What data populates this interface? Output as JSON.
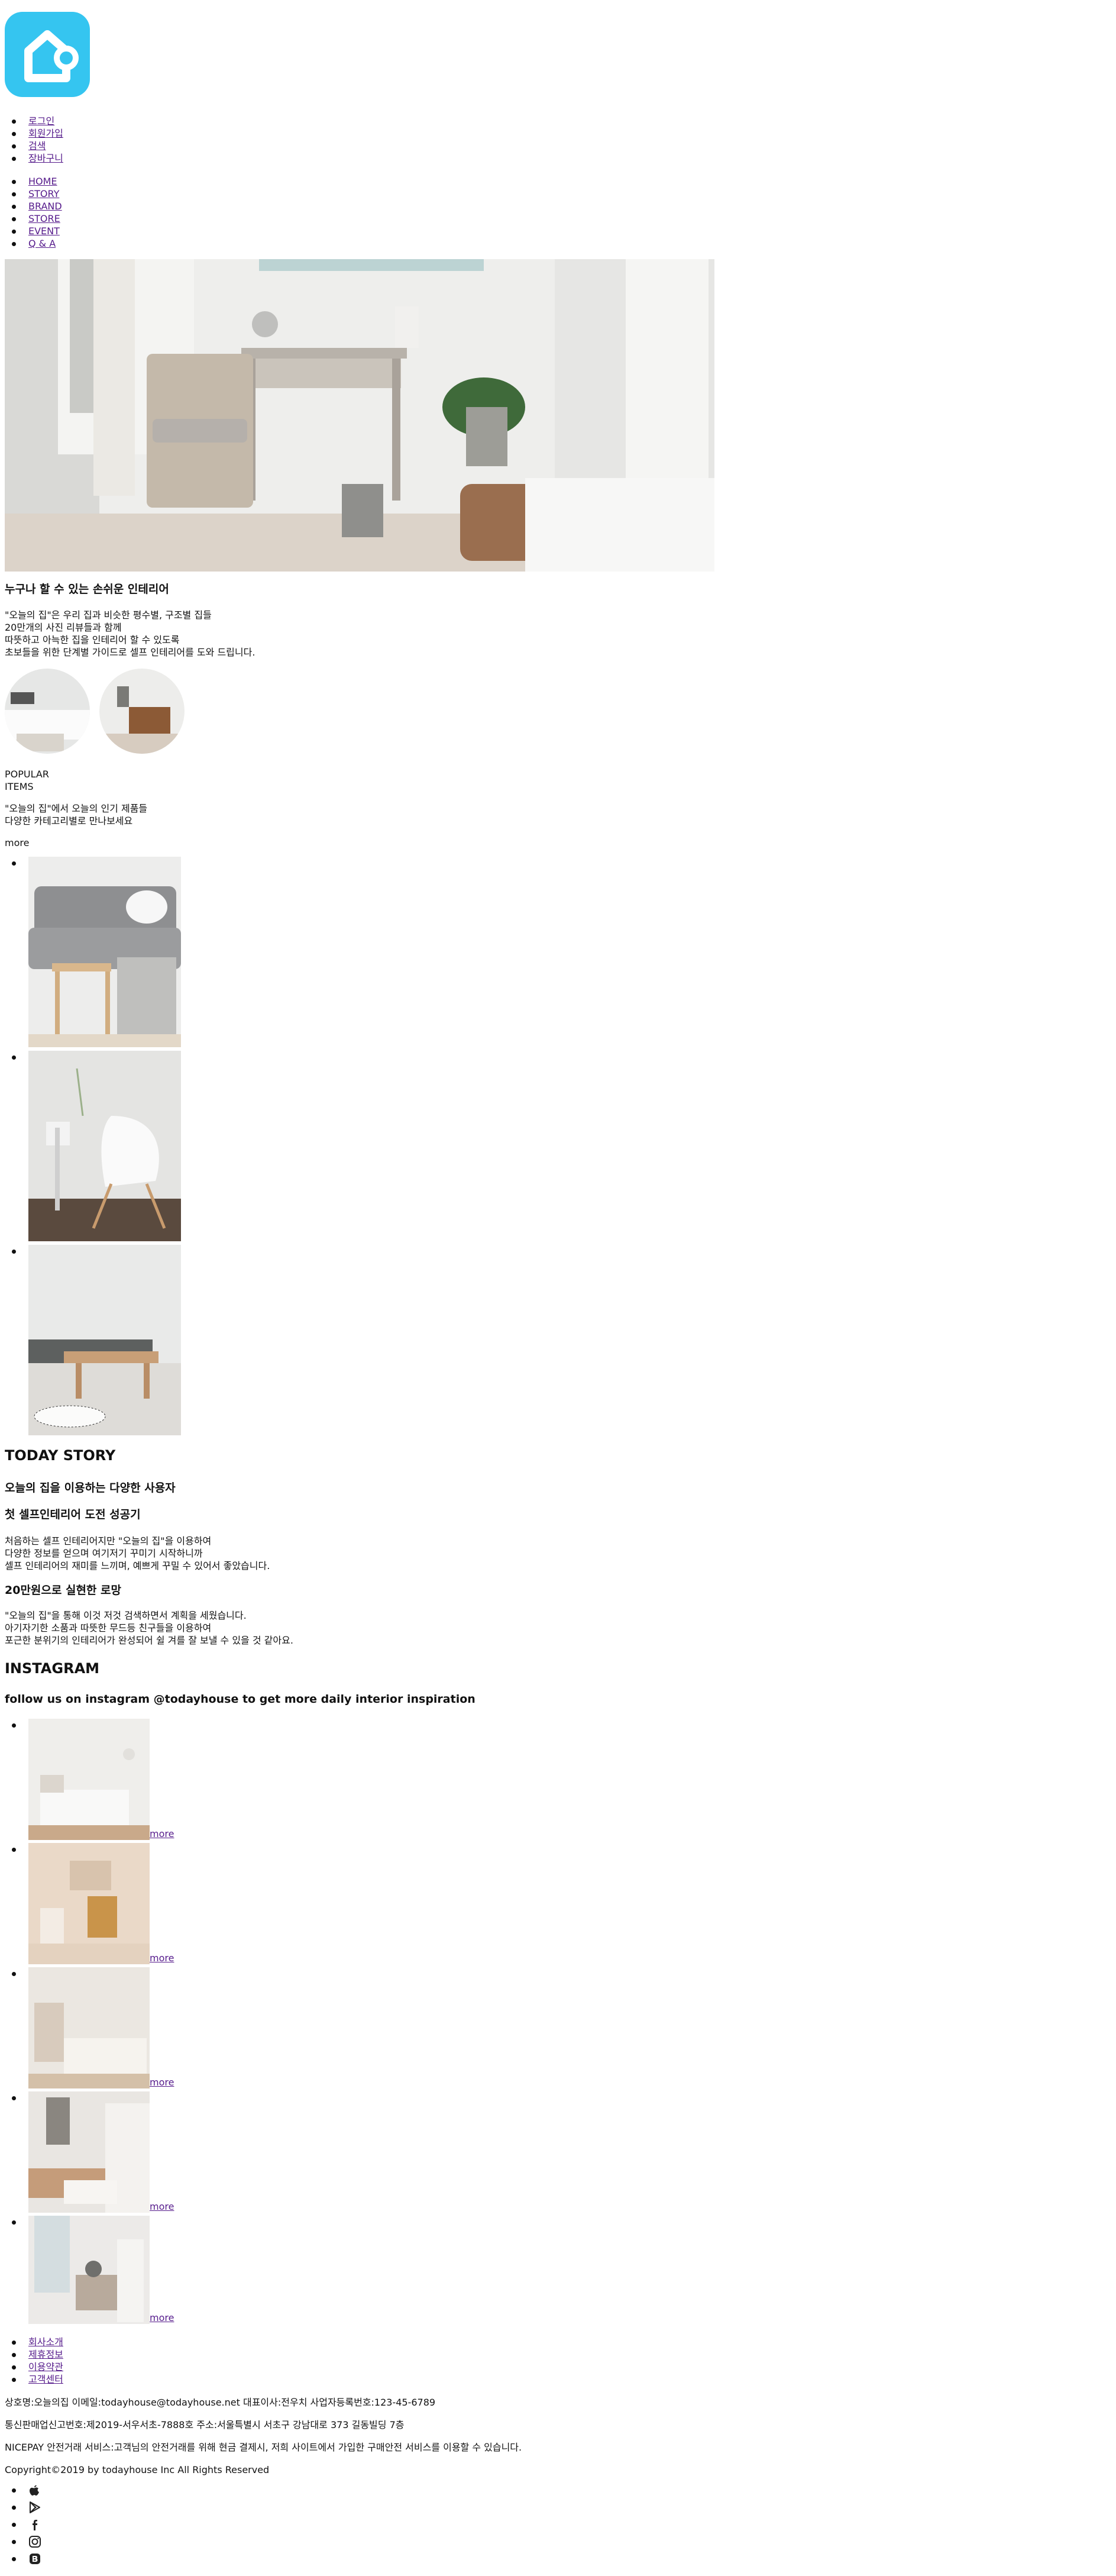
{
  "header": {
    "logo_icon": "house-logo-icon",
    "top_links": [
      "로그인",
      "회원가입",
      "검색",
      "장바구니"
    ],
    "nav": [
      "HOME",
      "STORY",
      "BRAND",
      "STORE",
      "EVENT",
      "Q & A"
    ]
  },
  "intro": {
    "title": "누구나 할 수 있는 손쉬운 인테리어",
    "lines": [
      "\"오늘의 집\"은 우리 집과 비슷한 평수별, 구조별 집들",
      "20만개의 사진 리뷰들과 함께",
      "따뜻하고 아늑한 집을 인테리어 할 수 있도록",
      "초보들을 위한 단계별 가이드로 셀프 인테리어를 도와 드립니다."
    ]
  },
  "popular": {
    "label_1": "POPULAR",
    "label_2": "ITEMS",
    "desc_1": "\"오늘의 집\"에서 오늘의 인기 제품들",
    "desc_2": "다양한 카테고리별로 만나보세요",
    "more": "more"
  },
  "story": {
    "heading": "TODAY STORY",
    "subheading": "오늘의 집을 이용하는 다양한 사용자",
    "post1_title": "첫 셀프인테리어 도전 성공기",
    "post1_lines": [
      "처음하는 셀프 인테리어지만 \"오늘의 집\"을 이용하여",
      "다양한 정보를 얻으며 여기저기 꾸미기 시작하니까",
      "셀프 인테리어의 재미를 느끼며, 예쁘게 꾸밀 수 있어서 좋았습니다."
    ],
    "post2_title": "20만원으로 실현한 로망",
    "post2_lines": [
      "\"오늘의 집\"을 통해 이것 저것 검색하면서 계획을 세웠습니다.",
      "아기자기한 소품과 따뜻한 무드등 친구들을 이용하여",
      "포근한 분위기의 인테리어가 완성되어 쉴 겨를 잘 보낼 수 있을 것 같아요."
    ]
  },
  "instagram": {
    "heading": "INSTAGRAM",
    "subheading": "follow us on instagram @todayhouse to get more daily interior inspiration",
    "more_links": [
      "more",
      "more",
      "more",
      "more",
      "more"
    ]
  },
  "footer": {
    "links": [
      "회사소개",
      "제휴정보",
      "이용약관",
      "고객센터"
    ],
    "company_info": "상호명:오늘의집 이메일:todayhouse@todayhouse.net 대표이사:전우치 사업자등록번호:123-45-6789",
    "address": "통신판매업신고번호:제2019-서우서초-7888호 주소:서울특별시 서초구 강남대로 373 길동빌딩 7층",
    "nicepay": "NICEPAY 안전거래 서비스:고객님의 안전거래를 위해 현금 결제시, 저희 사이트에서 가입한 구매안전 서비스를 이용할 수 있습니다.",
    "copyright": "Copyright©2019 by todayhouse Inc All Rights Reserved",
    "social_icons": [
      "apple-icon",
      "google-play-icon",
      "facebook-icon",
      "instagram-icon",
      "blog-icon"
    ]
  }
}
